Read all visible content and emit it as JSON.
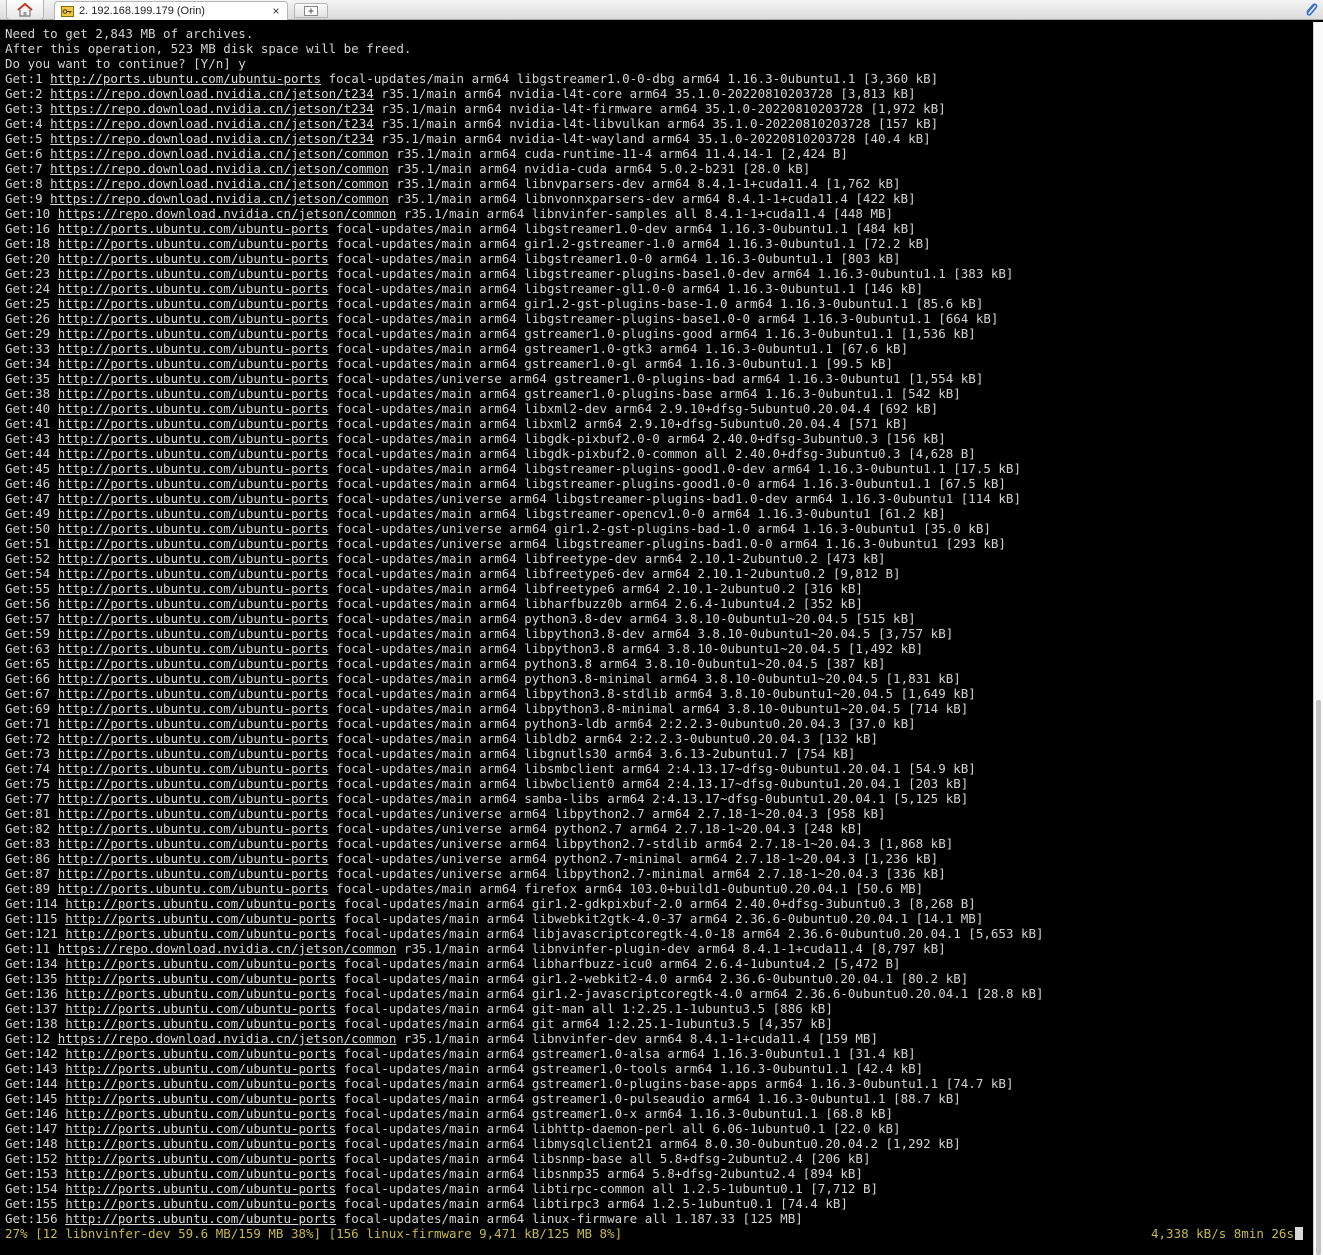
{
  "tab_bar": {
    "home_icon": "home-icon",
    "tab_icon": "terminal-key-icon",
    "tab_title": "2. 192.168.199.179 (Orin)",
    "close_symbol": "×",
    "new_tab_icon": "new-tab-icon",
    "attach_icon": "paperclip-icon"
  },
  "terminal": {
    "lines": [
      {
        "pre": "Need to get 2,843 MB of archives.",
        "url": "",
        "rest": ""
      },
      {
        "pre": "After this operation, 523 MB disk space will be freed.",
        "url": "",
        "rest": ""
      },
      {
        "pre": "Do you want to continue? [Y/n] y",
        "url": "",
        "rest": ""
      },
      {
        "pre": "Get:1 ",
        "url": "http://ports.ubuntu.com/ubuntu-ports",
        "rest": " focal-updates/main arm64 libgstreamer1.0-0-dbg arm64 1.16.3-0ubuntu1.1 [3,360 kB]"
      },
      {
        "pre": "Get:2 ",
        "url": "https://repo.download.nvidia.cn/jetson/t234",
        "rest": " r35.1/main arm64 nvidia-l4t-core arm64 35.1.0-20220810203728 [3,813 kB]"
      },
      {
        "pre": "Get:3 ",
        "url": "https://repo.download.nvidia.cn/jetson/t234",
        "rest": " r35.1/main arm64 nvidia-l4t-firmware arm64 35.1.0-20220810203728 [1,972 kB]"
      },
      {
        "pre": "Get:4 ",
        "url": "https://repo.download.nvidia.cn/jetson/t234",
        "rest": " r35.1/main arm64 nvidia-l4t-libvulkan arm64 35.1.0-20220810203728 [157 kB]"
      },
      {
        "pre": "Get:5 ",
        "url": "https://repo.download.nvidia.cn/jetson/t234",
        "rest": " r35.1/main arm64 nvidia-l4t-wayland arm64 35.1.0-20220810203728 [40.4 kB]"
      },
      {
        "pre": "Get:6 ",
        "url": "https://repo.download.nvidia.cn/jetson/common",
        "rest": " r35.1/main arm64 cuda-runtime-11-4 arm64 11.4.14-1 [2,424 B]"
      },
      {
        "pre": "Get:7 ",
        "url": "https://repo.download.nvidia.cn/jetson/common",
        "rest": " r35.1/main arm64 nvidia-cuda arm64 5.0.2-b231 [28.0 kB]"
      },
      {
        "pre": "Get:8 ",
        "url": "https://repo.download.nvidia.cn/jetson/common",
        "rest": " r35.1/main arm64 libnvparsers-dev arm64 8.4.1-1+cuda11.4 [1,762 kB]"
      },
      {
        "pre": "Get:9 ",
        "url": "https://repo.download.nvidia.cn/jetson/common",
        "rest": " r35.1/main arm64 libnvonnxparsers-dev arm64 8.4.1-1+cuda11.4 [422 kB]"
      },
      {
        "pre": "Get:10 ",
        "url": "https://repo.download.nvidia.cn/jetson/common",
        "rest": " r35.1/main arm64 libnvinfer-samples all 8.4.1-1+cuda11.4 [448 MB]"
      },
      {
        "pre": "Get:16 ",
        "url": "http://ports.ubuntu.com/ubuntu-ports",
        "rest": " focal-updates/main arm64 libgstreamer1.0-dev arm64 1.16.3-0ubuntu1.1 [484 kB]"
      },
      {
        "pre": "Get:18 ",
        "url": "http://ports.ubuntu.com/ubuntu-ports",
        "rest": " focal-updates/main arm64 gir1.2-gstreamer-1.0 arm64 1.16.3-0ubuntu1.1 [72.2 kB]"
      },
      {
        "pre": "Get:20 ",
        "url": "http://ports.ubuntu.com/ubuntu-ports",
        "rest": " focal-updates/main arm64 libgstreamer1.0-0 arm64 1.16.3-0ubuntu1.1 [803 kB]"
      },
      {
        "pre": "Get:23 ",
        "url": "http://ports.ubuntu.com/ubuntu-ports",
        "rest": " focal-updates/main arm64 libgstreamer-plugins-base1.0-dev arm64 1.16.3-0ubuntu1.1 [383 kB]"
      },
      {
        "pre": "Get:24 ",
        "url": "http://ports.ubuntu.com/ubuntu-ports",
        "rest": " focal-updates/main arm64 libgstreamer-gl1.0-0 arm64 1.16.3-0ubuntu1.1 [146 kB]"
      },
      {
        "pre": "Get:25 ",
        "url": "http://ports.ubuntu.com/ubuntu-ports",
        "rest": " focal-updates/main arm64 gir1.2-gst-plugins-base-1.0 arm64 1.16.3-0ubuntu1.1 [85.6 kB]"
      },
      {
        "pre": "Get:26 ",
        "url": "http://ports.ubuntu.com/ubuntu-ports",
        "rest": " focal-updates/main arm64 libgstreamer-plugins-base1.0-0 arm64 1.16.3-0ubuntu1.1 [664 kB]"
      },
      {
        "pre": "Get:29 ",
        "url": "http://ports.ubuntu.com/ubuntu-ports",
        "rest": " focal-updates/main arm64 gstreamer1.0-plugins-good arm64 1.16.3-0ubuntu1.1 [1,536 kB]"
      },
      {
        "pre": "Get:33 ",
        "url": "http://ports.ubuntu.com/ubuntu-ports",
        "rest": " focal-updates/main arm64 gstreamer1.0-gtk3 arm64 1.16.3-0ubuntu1.1 [67.6 kB]"
      },
      {
        "pre": "Get:34 ",
        "url": "http://ports.ubuntu.com/ubuntu-ports",
        "rest": " focal-updates/main arm64 gstreamer1.0-gl arm64 1.16.3-0ubuntu1.1 [99.5 kB]"
      },
      {
        "pre": "Get:35 ",
        "url": "http://ports.ubuntu.com/ubuntu-ports",
        "rest": " focal-updates/universe arm64 gstreamer1.0-plugins-bad arm64 1.16.3-0ubuntu1 [1,554 kB]"
      },
      {
        "pre": "Get:38 ",
        "url": "http://ports.ubuntu.com/ubuntu-ports",
        "rest": " focal-updates/main arm64 gstreamer1.0-plugins-base arm64 1.16.3-0ubuntu1.1 [542 kB]"
      },
      {
        "pre": "Get:40 ",
        "url": "http://ports.ubuntu.com/ubuntu-ports",
        "rest": " focal-updates/main arm64 libxml2-dev arm64 2.9.10+dfsg-5ubuntu0.20.04.4 [692 kB]"
      },
      {
        "pre": "Get:41 ",
        "url": "http://ports.ubuntu.com/ubuntu-ports",
        "rest": " focal-updates/main arm64 libxml2 arm64 2.9.10+dfsg-5ubuntu0.20.04.4 [571 kB]"
      },
      {
        "pre": "Get:43 ",
        "url": "http://ports.ubuntu.com/ubuntu-ports",
        "rest": " focal-updates/main arm64 libgdk-pixbuf2.0-0 arm64 2.40.0+dfsg-3ubuntu0.3 [156 kB]"
      },
      {
        "pre": "Get:44 ",
        "url": "http://ports.ubuntu.com/ubuntu-ports",
        "rest": " focal-updates/main arm64 libgdk-pixbuf2.0-common all 2.40.0+dfsg-3ubuntu0.3 [4,628 B]"
      },
      {
        "pre": "Get:45 ",
        "url": "http://ports.ubuntu.com/ubuntu-ports",
        "rest": " focal-updates/main arm64 libgstreamer-plugins-good1.0-dev arm64 1.16.3-0ubuntu1.1 [17.5 kB]"
      },
      {
        "pre": "Get:46 ",
        "url": "http://ports.ubuntu.com/ubuntu-ports",
        "rest": " focal-updates/main arm64 libgstreamer-plugins-good1.0-0 arm64 1.16.3-0ubuntu1.1 [67.5 kB]"
      },
      {
        "pre": "Get:47 ",
        "url": "http://ports.ubuntu.com/ubuntu-ports",
        "rest": " focal-updates/universe arm64 libgstreamer-plugins-bad1.0-dev arm64 1.16.3-0ubuntu1 [114 kB]"
      },
      {
        "pre": "Get:49 ",
        "url": "http://ports.ubuntu.com/ubuntu-ports",
        "rest": " focal-updates/main arm64 libgstreamer-opencv1.0-0 arm64 1.16.3-0ubuntu1 [61.2 kB]"
      },
      {
        "pre": "Get:50 ",
        "url": "http://ports.ubuntu.com/ubuntu-ports",
        "rest": " focal-updates/universe arm64 gir1.2-gst-plugins-bad-1.0 arm64 1.16.3-0ubuntu1 [35.0 kB]"
      },
      {
        "pre": "Get:51 ",
        "url": "http://ports.ubuntu.com/ubuntu-ports",
        "rest": " focal-updates/universe arm64 libgstreamer-plugins-bad1.0-0 arm64 1.16.3-0ubuntu1 [293 kB]"
      },
      {
        "pre": "Get:52 ",
        "url": "http://ports.ubuntu.com/ubuntu-ports",
        "rest": " focal-updates/main arm64 libfreetype-dev arm64 2.10.1-2ubuntu0.2 [473 kB]"
      },
      {
        "pre": "Get:54 ",
        "url": "http://ports.ubuntu.com/ubuntu-ports",
        "rest": " focal-updates/main arm64 libfreetype6-dev arm64 2.10.1-2ubuntu0.2 [9,812 B]"
      },
      {
        "pre": "Get:55 ",
        "url": "http://ports.ubuntu.com/ubuntu-ports",
        "rest": " focal-updates/main arm64 libfreetype6 arm64 2.10.1-2ubuntu0.2 [316 kB]"
      },
      {
        "pre": "Get:56 ",
        "url": "http://ports.ubuntu.com/ubuntu-ports",
        "rest": " focal-updates/main arm64 libharfbuzz0b arm64 2.6.4-1ubuntu4.2 [352 kB]"
      },
      {
        "pre": "Get:57 ",
        "url": "http://ports.ubuntu.com/ubuntu-ports",
        "rest": " focal-updates/main arm64 python3.8-dev arm64 3.8.10-0ubuntu1~20.04.5 [515 kB]"
      },
      {
        "pre": "Get:59 ",
        "url": "http://ports.ubuntu.com/ubuntu-ports",
        "rest": " focal-updates/main arm64 libpython3.8-dev arm64 3.8.10-0ubuntu1~20.04.5 [3,757 kB]"
      },
      {
        "pre": "Get:63 ",
        "url": "http://ports.ubuntu.com/ubuntu-ports",
        "rest": " focal-updates/main arm64 libpython3.8 arm64 3.8.10-0ubuntu1~20.04.5 [1,492 kB]"
      },
      {
        "pre": "Get:65 ",
        "url": "http://ports.ubuntu.com/ubuntu-ports",
        "rest": " focal-updates/main arm64 python3.8 arm64 3.8.10-0ubuntu1~20.04.5 [387 kB]"
      },
      {
        "pre": "Get:66 ",
        "url": "http://ports.ubuntu.com/ubuntu-ports",
        "rest": " focal-updates/main arm64 python3.8-minimal arm64 3.8.10-0ubuntu1~20.04.5 [1,831 kB]"
      },
      {
        "pre": "Get:67 ",
        "url": "http://ports.ubuntu.com/ubuntu-ports",
        "rest": " focal-updates/main arm64 libpython3.8-stdlib arm64 3.8.10-0ubuntu1~20.04.5 [1,649 kB]"
      },
      {
        "pre": "Get:69 ",
        "url": "http://ports.ubuntu.com/ubuntu-ports",
        "rest": " focal-updates/main arm64 libpython3.8-minimal arm64 3.8.10-0ubuntu1~20.04.5 [714 kB]"
      },
      {
        "pre": "Get:71 ",
        "url": "http://ports.ubuntu.com/ubuntu-ports",
        "rest": " focal-updates/main arm64 python3-ldb arm64 2:2.2.3-0ubuntu0.20.04.3 [37.0 kB]"
      },
      {
        "pre": "Get:72 ",
        "url": "http://ports.ubuntu.com/ubuntu-ports",
        "rest": " focal-updates/main arm64 libldb2 arm64 2:2.2.3-0ubuntu0.20.04.3 [132 kB]"
      },
      {
        "pre": "Get:73 ",
        "url": "http://ports.ubuntu.com/ubuntu-ports",
        "rest": " focal-updates/main arm64 libgnutls30 arm64 3.6.13-2ubuntu1.7 [754 kB]"
      },
      {
        "pre": "Get:74 ",
        "url": "http://ports.ubuntu.com/ubuntu-ports",
        "rest": " focal-updates/main arm64 libsmbclient arm64 2:4.13.17~dfsg-0ubuntu1.20.04.1 [54.9 kB]"
      },
      {
        "pre": "Get:75 ",
        "url": "http://ports.ubuntu.com/ubuntu-ports",
        "rest": " focal-updates/main arm64 libwbclient0 arm64 2:4.13.17~dfsg-0ubuntu1.20.04.1 [203 kB]"
      },
      {
        "pre": "Get:77 ",
        "url": "http://ports.ubuntu.com/ubuntu-ports",
        "rest": " focal-updates/main arm64 samba-libs arm64 2:4.13.17~dfsg-0ubuntu1.20.04.1 [5,125 kB]"
      },
      {
        "pre": "Get:81 ",
        "url": "http://ports.ubuntu.com/ubuntu-ports",
        "rest": " focal-updates/universe arm64 libpython2.7 arm64 2.7.18-1~20.04.3 [958 kB]"
      },
      {
        "pre": "Get:82 ",
        "url": "http://ports.ubuntu.com/ubuntu-ports",
        "rest": " focal-updates/universe arm64 python2.7 arm64 2.7.18-1~20.04.3 [248 kB]"
      },
      {
        "pre": "Get:83 ",
        "url": "http://ports.ubuntu.com/ubuntu-ports",
        "rest": " focal-updates/universe arm64 libpython2.7-stdlib arm64 2.7.18-1~20.04.3 [1,868 kB]"
      },
      {
        "pre": "Get:86 ",
        "url": "http://ports.ubuntu.com/ubuntu-ports",
        "rest": " focal-updates/universe arm64 python2.7-minimal arm64 2.7.18-1~20.04.3 [1,236 kB]"
      },
      {
        "pre": "Get:87 ",
        "url": "http://ports.ubuntu.com/ubuntu-ports",
        "rest": " focal-updates/universe arm64 libpython2.7-minimal arm64 2.7.18-1~20.04.3 [336 kB]"
      },
      {
        "pre": "Get:89 ",
        "url": "http://ports.ubuntu.com/ubuntu-ports",
        "rest": " focal-updates/main arm64 firefox arm64 103.0+build1-0ubuntu0.20.04.1 [50.6 MB]"
      },
      {
        "pre": "Get:114 ",
        "url": "http://ports.ubuntu.com/ubuntu-ports",
        "rest": " focal-updates/main arm64 gir1.2-gdkpixbuf-2.0 arm64 2.40.0+dfsg-3ubuntu0.3 [8,268 B]"
      },
      {
        "pre": "Get:115 ",
        "url": "http://ports.ubuntu.com/ubuntu-ports",
        "rest": " focal-updates/main arm64 libwebkit2gtk-4.0-37 arm64 2.36.6-0ubuntu0.20.04.1 [14.1 MB]"
      },
      {
        "pre": "Get:121 ",
        "url": "http://ports.ubuntu.com/ubuntu-ports",
        "rest": " focal-updates/main arm64 libjavascriptcoregtk-4.0-18 arm64 2.36.6-0ubuntu0.20.04.1 [5,653 kB]"
      },
      {
        "pre": "Get:11 ",
        "url": "https://repo.download.nvidia.cn/jetson/common",
        "rest": " r35.1/main arm64 libnvinfer-plugin-dev arm64 8.4.1-1+cuda11.4 [8,797 kB]"
      },
      {
        "pre": "Get:134 ",
        "url": "http://ports.ubuntu.com/ubuntu-ports",
        "rest": " focal-updates/main arm64 libharfbuzz-icu0 arm64 2.6.4-1ubuntu4.2 [5,472 B]"
      },
      {
        "pre": "Get:135 ",
        "url": "http://ports.ubuntu.com/ubuntu-ports",
        "rest": " focal-updates/main arm64 gir1.2-webkit2-4.0 arm64 2.36.6-0ubuntu0.20.04.1 [80.2 kB]"
      },
      {
        "pre": "Get:136 ",
        "url": "http://ports.ubuntu.com/ubuntu-ports",
        "rest": " focal-updates/main arm64 gir1.2-javascriptcoregtk-4.0 arm64 2.36.6-0ubuntu0.20.04.1 [28.8 kB]"
      },
      {
        "pre": "Get:137 ",
        "url": "http://ports.ubuntu.com/ubuntu-ports",
        "rest": " focal-updates/main arm64 git-man all 1:2.25.1-1ubuntu3.5 [886 kB]"
      },
      {
        "pre": "Get:138 ",
        "url": "http://ports.ubuntu.com/ubuntu-ports",
        "rest": " focal-updates/main arm64 git arm64 1:2.25.1-1ubuntu3.5 [4,357 kB]"
      },
      {
        "pre": "Get:12 ",
        "url": "https://repo.download.nvidia.cn/jetson/common",
        "rest": " r35.1/main arm64 libnvinfer-dev arm64 8.4.1-1+cuda11.4 [159 MB]"
      },
      {
        "pre": "Get:142 ",
        "url": "http://ports.ubuntu.com/ubuntu-ports",
        "rest": " focal-updates/main arm64 gstreamer1.0-alsa arm64 1.16.3-0ubuntu1.1 [31.4 kB]"
      },
      {
        "pre": "Get:143 ",
        "url": "http://ports.ubuntu.com/ubuntu-ports",
        "rest": " focal-updates/main arm64 gstreamer1.0-tools arm64 1.16.3-0ubuntu1.1 [42.4 kB]"
      },
      {
        "pre": "Get:144 ",
        "url": "http://ports.ubuntu.com/ubuntu-ports",
        "rest": " focal-updates/main arm64 gstreamer1.0-plugins-base-apps arm64 1.16.3-0ubuntu1.1 [74.7 kB]"
      },
      {
        "pre": "Get:145 ",
        "url": "http://ports.ubuntu.com/ubuntu-ports",
        "rest": " focal-updates/main arm64 gstreamer1.0-pulseaudio arm64 1.16.3-0ubuntu1.1 [88.7 kB]"
      },
      {
        "pre": "Get:146 ",
        "url": "http://ports.ubuntu.com/ubuntu-ports",
        "rest": " focal-updates/main arm64 gstreamer1.0-x arm64 1.16.3-0ubuntu1.1 [68.8 kB]"
      },
      {
        "pre": "Get:147 ",
        "url": "http://ports.ubuntu.com/ubuntu-ports",
        "rest": " focal-updates/main arm64 libhttp-daemon-perl all 6.06-1ubuntu0.1 [22.0 kB]"
      },
      {
        "pre": "Get:148 ",
        "url": "http://ports.ubuntu.com/ubuntu-ports",
        "rest": " focal-updates/main arm64 libmysqlclient21 arm64 8.0.30-0ubuntu0.20.04.2 [1,292 kB]"
      },
      {
        "pre": "Get:152 ",
        "url": "http://ports.ubuntu.com/ubuntu-ports",
        "rest": " focal-updates/main arm64 libsnmp-base all 5.8+dfsg-2ubuntu2.4 [206 kB]"
      },
      {
        "pre": "Get:153 ",
        "url": "http://ports.ubuntu.com/ubuntu-ports",
        "rest": " focal-updates/main arm64 libsnmp35 arm64 5.8+dfsg-2ubuntu2.4 [894 kB]"
      },
      {
        "pre": "Get:154 ",
        "url": "http://ports.ubuntu.com/ubuntu-ports",
        "rest": " focal-updates/main arm64 libtirpc-common all 1.2.5-1ubuntu0.1 [7,712 B]"
      },
      {
        "pre": "Get:155 ",
        "url": "http://ports.ubuntu.com/ubuntu-ports",
        "rest": " focal-updates/main arm64 libtirpc3 arm64 1.2.5-1ubuntu0.1 [74.4 kB]"
      },
      {
        "pre": "Get:156 ",
        "url": "http://ports.ubuntu.com/ubuntu-ports",
        "rest": " focal-updates/main arm64 linux-firmware all 1.187.33 [125 MB]"
      }
    ],
    "status_left": "27% [12 libnvinfer-dev 59.6 MB/159 MB 38%] [156 linux-firmware 9,471 kB/125 MB 8%]",
    "status_right": "4,338 kB/s 8min 26s"
  },
  "scrollbar": {
    "position_fraction": 0.55,
    "visible_fraction": 0.45
  },
  "colors": {
    "terminal_bg": "#000000",
    "terminal_fg": "#d3d3d3",
    "status_fg": "#c7b94a"
  }
}
